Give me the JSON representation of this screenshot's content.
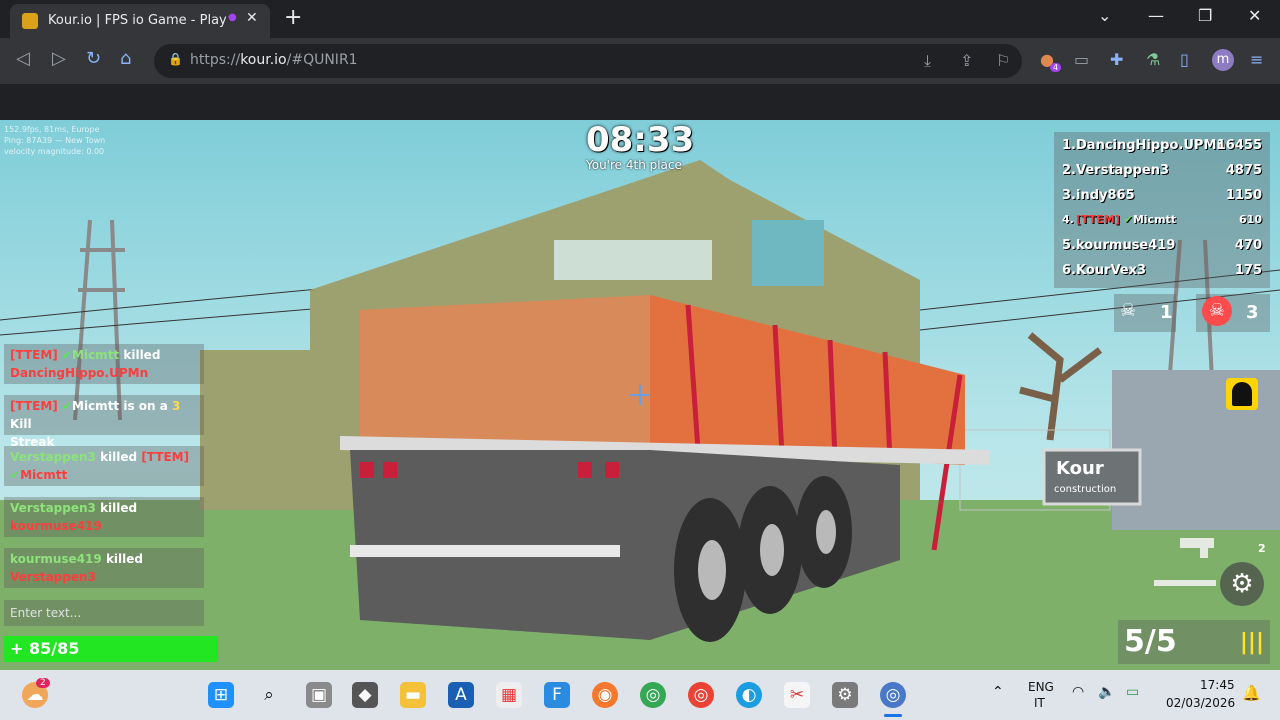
{
  "browser": {
    "tab_title": "Kour.io | FPS io Game - Play",
    "tab_close": "✕",
    "new_tab": "+",
    "url_host": "kour.io",
    "url_prefix": "https://",
    "url_path": "/#QUNIR1",
    "profile_initial": "m",
    "ext_badge": "4",
    "window_controls": [
      "⌄",
      "—",
      "❐",
      "✕"
    ]
  },
  "game": {
    "stats_lines": [
      "152.9fps, 81ms, Europe",
      "Ping: 87A39 — New Town",
      "velocity magnitude: 0.00"
    ],
    "timer": "08:33",
    "place_text": "You're 4th place",
    "leaderboard": [
      {
        "rank": "1.",
        "name": "DancingHippo.UPMn",
        "score": "16455",
        "tag": ""
      },
      {
        "rank": "2.",
        "name": "Verstappen3",
        "score": "4875",
        "tag": ""
      },
      {
        "rank": "3.",
        "name": "indy865",
        "score": "1150",
        "tag": ""
      },
      {
        "rank": "4.",
        "name": "Micmtt",
        "score": "610",
        "tag": "[TTEM]"
      },
      {
        "rank": "5.",
        "name": "kourmuse419",
        "score": "470",
        "tag": ""
      },
      {
        "rank": "6.",
        "name": "KourVex3",
        "score": "175",
        "tag": ""
      }
    ],
    "kills": "1",
    "deaths": "3",
    "killfeed": [
      {
        "tag": "[TTEM]",
        "actor": "Micmtt",
        "verb": "killed",
        "target": "DancingHippo.UPMn"
      },
      {
        "tag": "[TTEM]",
        "actor": "Micmtt",
        "verb": "is on a",
        "streak": "3",
        "tail": "Kill",
        "line2": "Streak"
      },
      {
        "tag": "",
        "actor": "Verstappen3",
        "verb": "killed",
        "target_tag": "[TTEM]",
        "target": "Micmtt"
      },
      {
        "tag": "",
        "actor": "Verstappen3",
        "verb": "killed",
        "target": "kourmuse419"
      },
      {
        "tag": "",
        "actor": "kourmuse419",
        "verb": "killed",
        "target": "Verstappen3"
      }
    ],
    "chat_placeholder": "Enter text...",
    "health": "+ 85/85",
    "health_fraction": 1.0,
    "ammo": "5/5",
    "ammo_bars": "|||",
    "weapon_slot": "2",
    "sign_text": "Kour",
    "sign_sub": "construction"
  },
  "taskbar": {
    "notif_badge": "2",
    "lang_top": "ENG",
    "lang_bottom": "IT",
    "time": "17:45",
    "date": "02/03/2026"
  }
}
